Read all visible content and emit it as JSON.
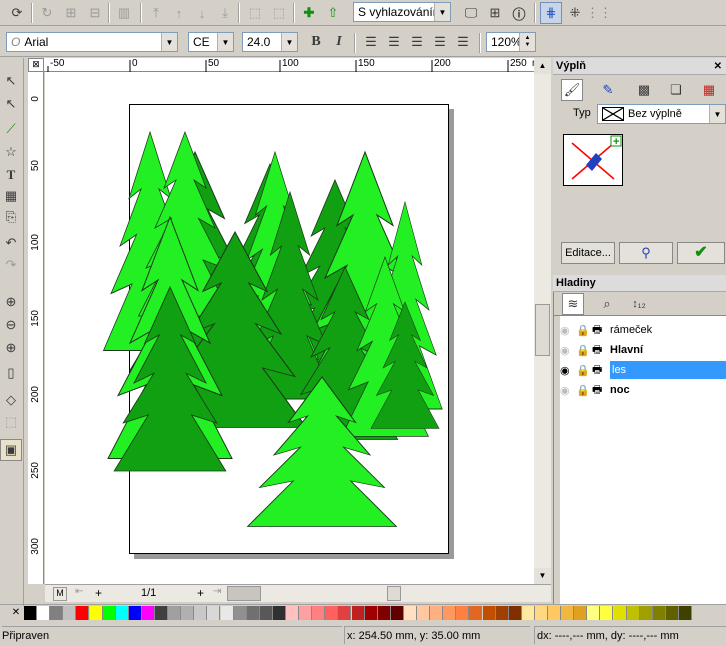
{
  "toolbar": {
    "antialias_mode": "S vyhlazováním"
  },
  "format_bar": {
    "font": "Arial",
    "charset": "CE",
    "font_size": "24.0",
    "zoom": "120%"
  },
  "ruler": {
    "h_ticks": [
      "-50",
      "0",
      "50",
      "100",
      "150",
      "200",
      "250",
      "mm"
    ],
    "v_ticks": [
      "0",
      "50",
      "100",
      "150",
      "200",
      "250",
      "300"
    ]
  },
  "page_nav": {
    "master": "M",
    "page": "1/1"
  },
  "fill_panel": {
    "title": "Výplň",
    "type_label": "Typ",
    "type_value": "Bez výplně",
    "edit_button": "Editace..."
  },
  "layers_panel": {
    "title": "Hladiny",
    "layers": [
      {
        "name": "rámeček",
        "bold": false,
        "selected": false
      },
      {
        "name": "Hlavní",
        "bold": true,
        "selected": false
      },
      {
        "name": "les",
        "bold": false,
        "selected": true
      },
      {
        "name": "noc",
        "bold": true,
        "selected": false
      }
    ]
  },
  "status": {
    "state": "Připraven",
    "coords": "x: 254.50 mm, y: 35.00 mm",
    "delta": "dx: ----,--- mm, dy: ----,--- mm"
  },
  "palette": [
    "#000000",
    "#ffffff",
    "#808080",
    "#c0c0c0",
    "#ff0000",
    "#ffff00",
    "#00ff00",
    "#00ffff",
    "#0000ff",
    "#ff00ff",
    "#404040",
    "#a0a0a0",
    "#b0b0b0",
    "#c8c8c8",
    "#d8d8d8",
    "#e8e8e8",
    "#909090",
    "#707070",
    "#585858",
    "#303030",
    "#ffc0c0",
    "#ffa0a0",
    "#ff8080",
    "#ff6060",
    "#e04040",
    "#c02020",
    "#a00000",
    "#800000",
    "#600000",
    "#ffe0c0",
    "#ffc8a0",
    "#ffb080",
    "#ff9860",
    "#ff8040",
    "#e06820",
    "#c05000",
    "#a04000",
    "#803000",
    "#ffe8a0",
    "#ffd880",
    "#ffc860",
    "#f0b840",
    "#e0a020",
    "#ffff80",
    "#ffff40",
    "#e0e000",
    "#c0c000",
    "#a0a000",
    "#808000",
    "#606000",
    "#404000"
  ]
}
